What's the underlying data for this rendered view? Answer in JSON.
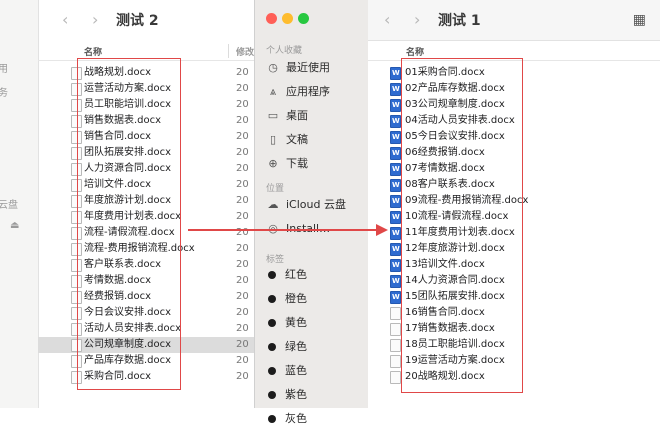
{
  "left_window": {
    "title": "测试 2",
    "nav_back": "‹",
    "nav_forward": "›",
    "stub_labels": [
      "用",
      "务",
      "云盘"
    ],
    "col_name": "名称",
    "col_date": "修改",
    "files": [
      {
        "name": "战略规划.docx",
        "date": "20"
      },
      {
        "name": "运营活动方案.docx",
        "date": "20"
      },
      {
        "name": "员工职能培训.docx",
        "date": "20"
      },
      {
        "name": "销售数据表.docx",
        "date": "20"
      },
      {
        "name": "销售合同.docx",
        "date": "20"
      },
      {
        "name": "团队拓展安排.docx",
        "date": "20"
      },
      {
        "name": "人力资源合同.docx",
        "date": "20"
      },
      {
        "name": "培训文件.docx",
        "date": "20"
      },
      {
        "name": "年度旅游计划.docx",
        "date": "20"
      },
      {
        "name": "年度费用计划表.docx",
        "date": "20"
      },
      {
        "name": "流程-请假流程.docx",
        "date": "20"
      },
      {
        "name": "流程-费用报销流程.docx",
        "date": "20"
      },
      {
        "name": "客户联系表.docx",
        "date": "20"
      },
      {
        "name": "考情数据.docx",
        "date": "20"
      },
      {
        "name": "经费报销.docx",
        "date": "20"
      },
      {
        "name": "今日会议安排.docx",
        "date": "20"
      },
      {
        "name": "活动人员安排表.docx",
        "date": "20"
      },
      {
        "name": "公司规章制度.docx",
        "date": "20"
      },
      {
        "name": "产品库存数据.docx",
        "date": "20"
      },
      {
        "name": "采购合同.docx",
        "date": "20"
      }
    ],
    "selected_index": 17
  },
  "sidebar": {
    "favorites_header": "个人收藏",
    "favorites": [
      {
        "label": "最近使用",
        "icon": "clock-icon",
        "glyph": "◷"
      },
      {
        "label": "应用程序",
        "icon": "apps-icon",
        "glyph": "⩓"
      },
      {
        "label": "桌面",
        "icon": "desktop-icon",
        "glyph": "▭"
      },
      {
        "label": "文稿",
        "icon": "document-icon",
        "glyph": "▯"
      },
      {
        "label": "下载",
        "icon": "download-icon",
        "glyph": "⊕"
      }
    ],
    "location_header": "位置",
    "locations": [
      {
        "label": "iCloud 云盘",
        "icon": "cloud-icon",
        "glyph": "☁"
      },
      {
        "label": "Install…",
        "icon": "disk-icon",
        "glyph": "◎"
      }
    ],
    "tags_header": "标签",
    "tags": [
      "红色",
      "橙色",
      "黄色",
      "绿色",
      "蓝色",
      "紫色",
      "灰色"
    ]
  },
  "right_window": {
    "title": "测试 1",
    "nav_back": "‹",
    "nav_forward": "›",
    "col_name": "名称",
    "view_glyph": "▦",
    "files": [
      "01采购合同.docx",
      "02产品库存数据.docx",
      "03公司规章制度.docx",
      "04活动人员安排表.docx",
      "05今日会议安排.docx",
      "06经费报销.docx",
      "07考情数据.docx",
      "08客户联系表.docx",
      "09流程-费用报销流程.docx",
      "10流程-请假流程.docx",
      "11年度费用计划表.docx",
      "12年度旅游计划.docx",
      "13培训文件.docx",
      "14人力资源合同.docx",
      "15团队拓展安排.docx",
      "16销售合同.docx",
      "17销售数据表.docx",
      "18员工职能培训.docx",
      "19运营活动方案.docx",
      "20战略规划.docx"
    ],
    "blue_icon_count": 15
  },
  "colors": {
    "annotation_red": "#e04848",
    "traffic_red": "#ff5f57",
    "traffic_yellow": "#febc2e",
    "traffic_green": "#28c840",
    "word_blue": "#2e6bd0"
  }
}
